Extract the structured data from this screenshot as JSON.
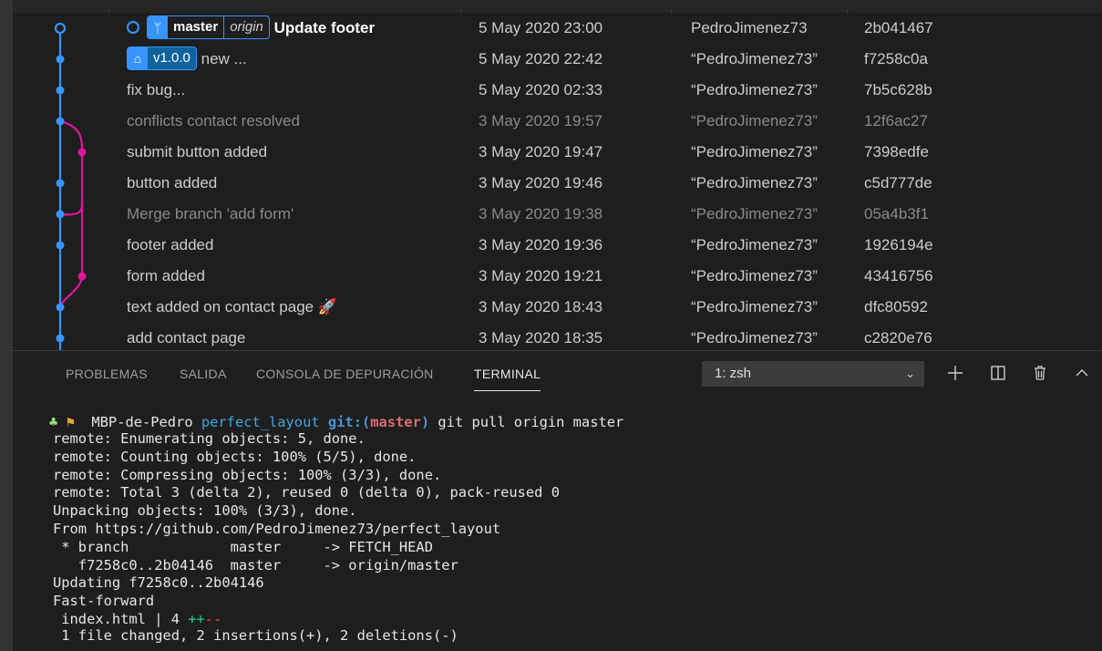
{
  "graph": {
    "rows": [
      {
        "message": "Update footer",
        "date": "5 May 2020 23:00",
        "author": "PedroJimenez73",
        "hash": "2b041467",
        "branch": "master",
        "remote": "origin",
        "head": true,
        "dim": false
      },
      {
        "message": "new ...",
        "date": "5 May 2020 22:42",
        "author": "“PedroJimenez73”",
        "hash": "f7258c0a",
        "tag": "v1.0.0",
        "dim": false
      },
      {
        "message": "fix bug...",
        "date": "5 May 2020 02:33",
        "author": "“PedroJimenez73”",
        "hash": "7b5c628b",
        "dim": false
      },
      {
        "message": "conflicts contact resolved",
        "date": "3 May 2020 19:57",
        "author": "“PedroJimenez73”",
        "hash": "12f6ac27",
        "dim": true
      },
      {
        "message": "submit button added",
        "date": "3 May 2020 19:47",
        "author": "“PedroJimenez73”",
        "hash": "7398edfe",
        "dim": false
      },
      {
        "message": "button added",
        "date": "3 May 2020 19:46",
        "author": "“PedroJimenez73”",
        "hash": "c5d777de",
        "dim": false
      },
      {
        "message": "Merge branch 'add form'",
        "date": "3 May 2020 19:38",
        "author": "“PedroJimenez73”",
        "hash": "05a4b3f1",
        "dim": true
      },
      {
        "message": "footer added",
        "date": "3 May 2020 19:36",
        "author": "“PedroJimenez73”",
        "hash": "1926194e",
        "dim": false
      },
      {
        "message": "form added",
        "date": "3 May 2020 19:21",
        "author": "“PedroJimenez73”",
        "hash": "43416756",
        "dim": false
      },
      {
        "message": "text added on contact page 🚀",
        "date": "3 May 2020 18:43",
        "author": "“PedroJimenez73”",
        "hash": "dfc80592",
        "dim": false
      },
      {
        "message": "add contact page",
        "date": "3 May 2020 18:35",
        "author": "“PedroJimenez73”",
        "hash": "c2820e76",
        "dim": false
      }
    ],
    "colors": {
      "main_rail": "#3794ff",
      "branch_rail": "#e0159e"
    }
  },
  "panel": {
    "tabs": [
      {
        "label": "PROBLEMAS",
        "active": false
      },
      {
        "label": "SALIDA",
        "active": false
      },
      {
        "label": "CONSOLA DE DEPURACIÓN",
        "active": false
      },
      {
        "label": "TERMINAL",
        "active": true
      }
    ],
    "terminal_select": "1: zsh",
    "actions": [
      "plus-icon",
      "split-icon",
      "trash-icon",
      "chevron-up-icon"
    ]
  },
  "terminal": {
    "prompt": {
      "host": "MBP-de-Pedro",
      "dir": "perfect_layout",
      "git": "git:(",
      "branch": "master",
      "git_close": ")",
      "command": "git pull origin master"
    },
    "lines": [
      "remote: Enumerating objects: 5, done.",
      "remote: Counting objects: 100% (5/5), done.",
      "remote: Compressing objects: 100% (3/3), done.",
      "remote: Total 3 (delta 2), reused 0 (delta 0), pack-reused 0",
      "Unpacking objects: 100% (3/3), done.",
      "From https://github.com/PedroJimenez73/perfect_layout",
      " * branch            master     -> FETCH_HEAD",
      "   f7258c0..2b04146  master     -> origin/master",
      "Updating f7258c0..2b04146",
      "Fast-forward"
    ],
    "diffstat": {
      "file": " index.html | 4 ",
      "plus": "++",
      "minus": "--"
    },
    "summary": " 1 file changed, 2 insertions(+), 2 deletions(-)"
  }
}
